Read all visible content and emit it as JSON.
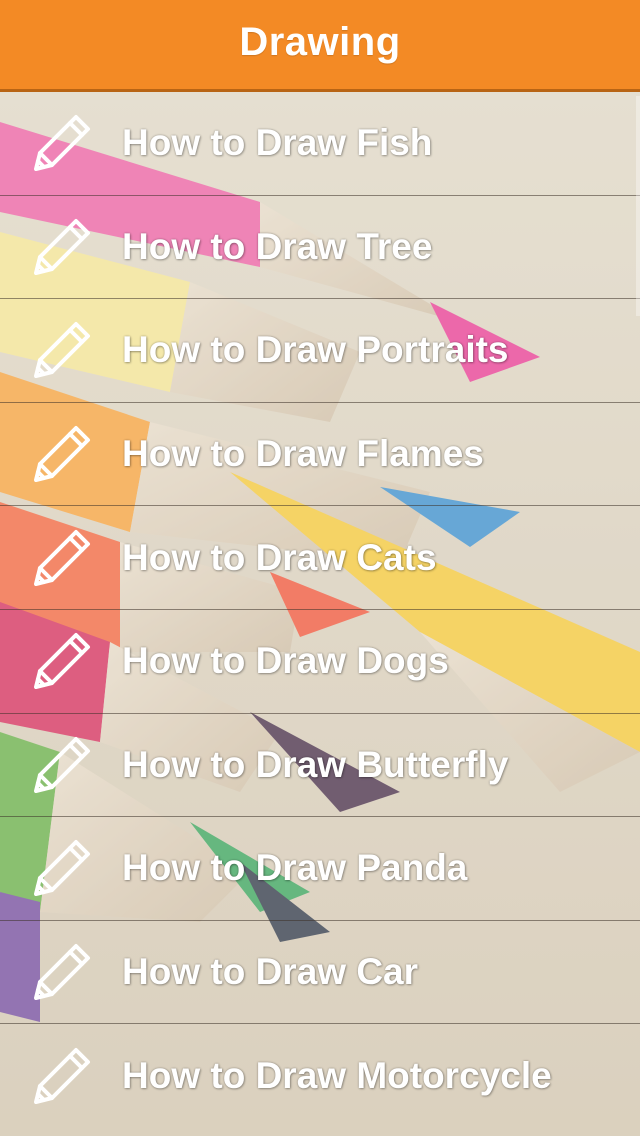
{
  "header": {
    "title": "Drawing",
    "background_color": "#f38a25"
  },
  "menu": {
    "icon": "pencil-icon",
    "items": [
      {
        "label": "How to Draw Fish"
      },
      {
        "label": "How to Draw Tree"
      },
      {
        "label": "How to Draw Portraits"
      },
      {
        "label": "How to Draw Flames"
      },
      {
        "label": "How to Draw Cats"
      },
      {
        "label": "How to Draw Dogs"
      },
      {
        "label": "How to Draw Butterfly"
      },
      {
        "label": "How to Draw Panda"
      },
      {
        "label": "How to Draw Car"
      },
      {
        "label": "How to Draw Motorcycle"
      }
    ]
  }
}
